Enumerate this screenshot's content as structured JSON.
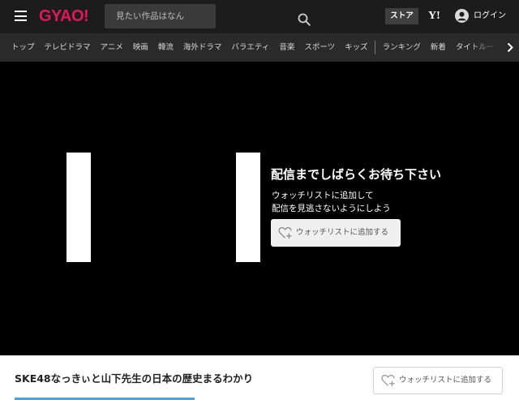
{
  "header": {
    "logo": "GYAO!",
    "search_placeholder": "見たい作品はなん",
    "store_label": "ストア",
    "yahoo_label": "Y!",
    "login_label": "ログイン",
    "brand_color": "#e3175b"
  },
  "nav": {
    "items": [
      "トップ",
      "テレビドラマ",
      "アニメ",
      "映画",
      "韓流",
      "海外ドラマ",
      "バラエティ",
      "音楽",
      "スポーツ",
      "キッズ"
    ],
    "items_right": [
      "ランキング",
      "新着",
      "タイトル一"
    ]
  },
  "player": {
    "wait_title": "配信までしばらくお待ち下さい",
    "wait_line1": "ウォッチリストに追加して",
    "wait_line2": "配信を見逃さないようにしよう",
    "watchlist_label": "ウォッチリストに追加する"
  },
  "info": {
    "title": "SKE48なっきぃと山下先生の日本の歴史まるわかり",
    "watchlist_label": "ウォッチリストに追加する"
  },
  "icons": {
    "menu": "hamburger-icon",
    "search": "search-icon",
    "user": "user-icon",
    "heart": "heart-plus-icon",
    "arrow": "chevron-right-icon"
  }
}
